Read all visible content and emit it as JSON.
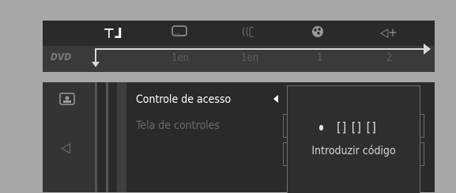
{
  "topbar": {
    "icons": [
      "settings-icon",
      "subtitle-icon",
      "audio-icon",
      "angle-icon",
      "speaker-icon"
    ],
    "disc_label": "DVD",
    "values": [
      "1en",
      "1en",
      "1",
      "2"
    ]
  },
  "sidebar": {
    "icons": [
      "display-icon",
      "speaker-icon"
    ]
  },
  "menu": {
    "items": [
      {
        "label": "Controle de acesso",
        "selected": true
      },
      {
        "label": "Tela de controles",
        "selected": false
      }
    ]
  },
  "popup": {
    "code_mask": "[] [] []",
    "prompt": "Introduzir código"
  }
}
